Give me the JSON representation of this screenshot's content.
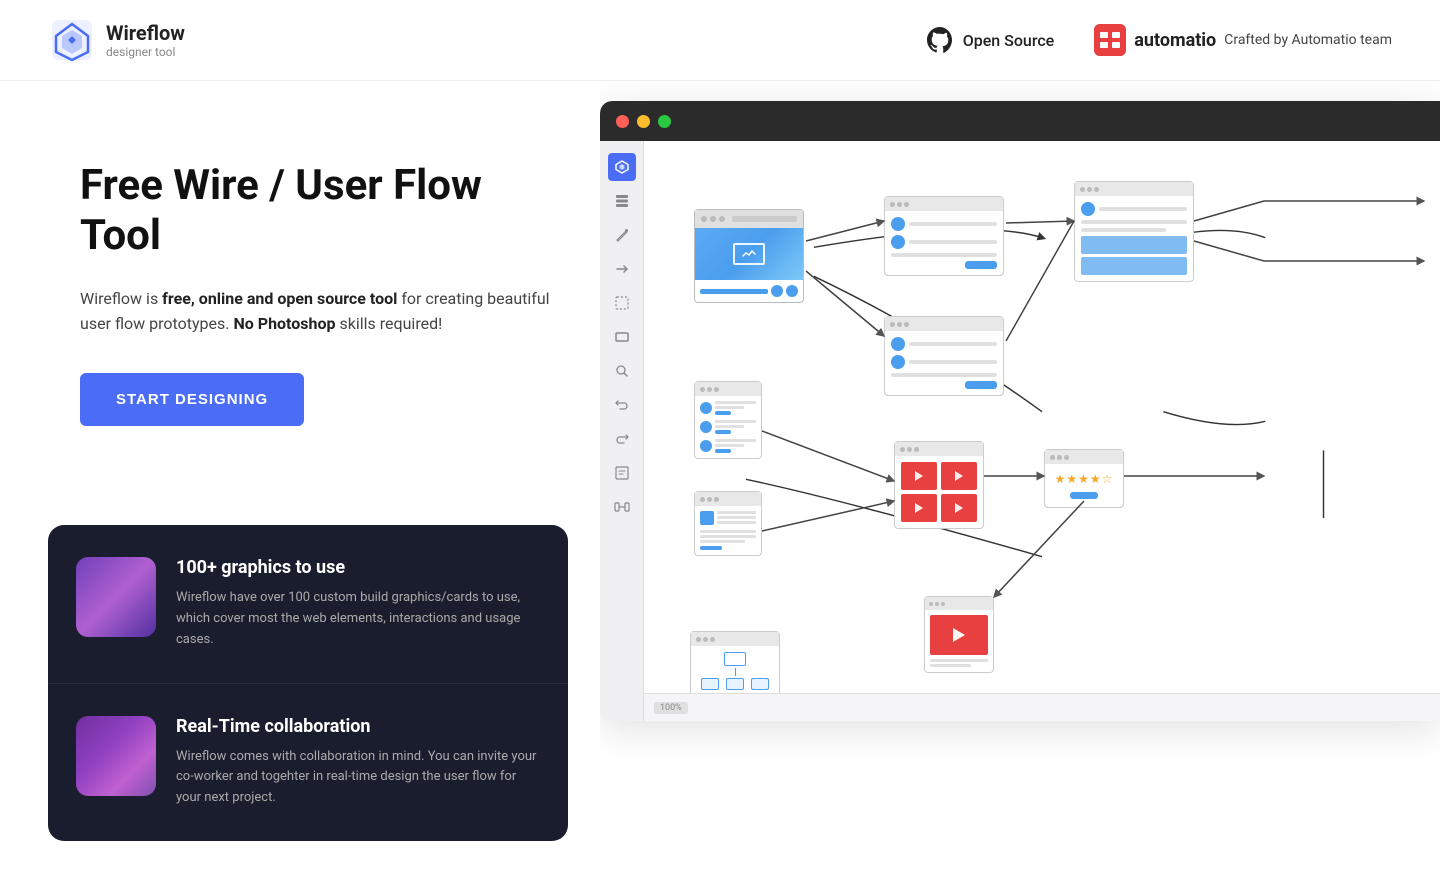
{
  "header": {
    "logo_title": "Wireflow",
    "logo_subtitle": "designer tool",
    "open_source_label": "Open Source",
    "automatio_name": "automatio",
    "automatio_crafted": "Crafted by Automatio team"
  },
  "hero": {
    "title": "Free Wire / User Flow Tool",
    "desc_before_bold": "Wireflow is ",
    "desc_bold": "free, online and open source tool",
    "desc_between": " for creating beautiful user flow prototypes. ",
    "desc_bold2": "No Photoshop",
    "desc_after": " skills required!",
    "cta_label": "START DESIGNING"
  },
  "features": [
    {
      "title": "100+ graphics to use",
      "desc": "Wireflow have over 100 custom build graphics/cards to use, which cover most the web elements, interactions and usage cases."
    },
    {
      "title": "Real-Time collaboration",
      "desc": "Wireflow comes with collaboration in mind. You can invite your co-worker and togehter in real-time design the user flow for your next project."
    }
  ],
  "app_window": {
    "title_bar_dots": [
      "red",
      "yellow",
      "green"
    ],
    "bottom_bar_text": "100%"
  },
  "icons": {
    "sidebar_items": [
      "wireflow-logo",
      "layers",
      "pen",
      "arrow",
      "crop",
      "zoom",
      "undo",
      "redo",
      "notes",
      "frame"
    ]
  }
}
